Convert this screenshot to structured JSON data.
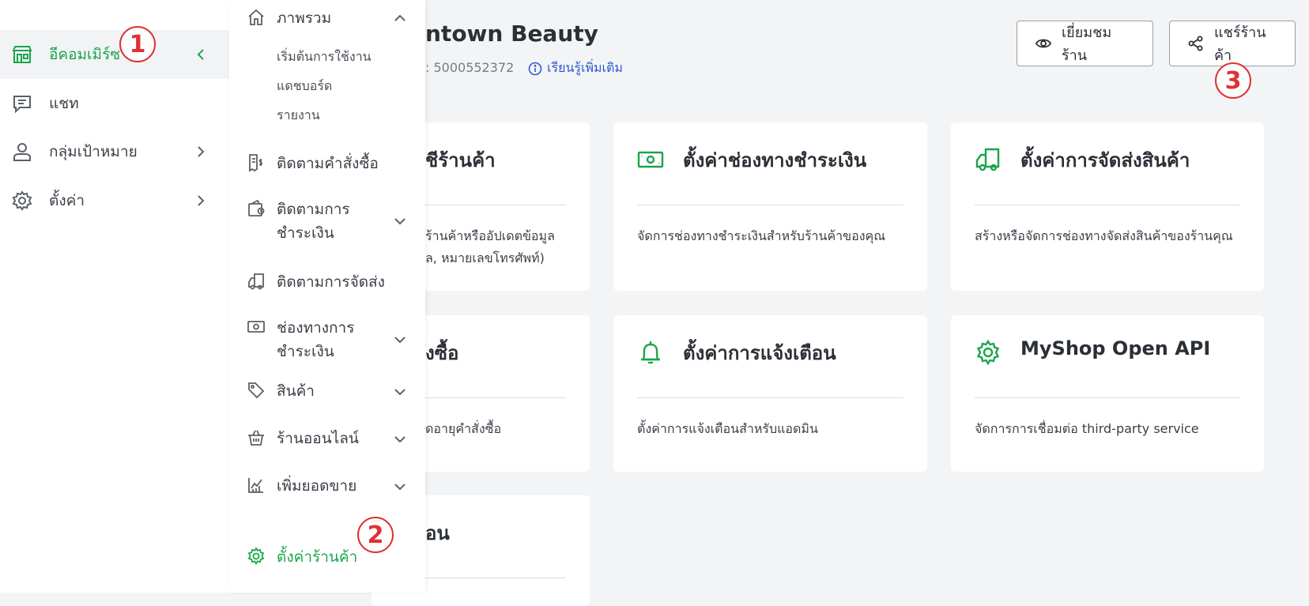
{
  "sidebar": {
    "items": [
      {
        "label": "อีคอมเมิร์ซ",
        "icon": "store-icon",
        "active": true
      },
      {
        "label": "แชท",
        "icon": "chat-icon"
      },
      {
        "label": "กลุ่มเป้าหมาย",
        "icon": "user-icon"
      },
      {
        "label": "ตั้งค่า",
        "icon": "gear-icon"
      }
    ]
  },
  "submenu": {
    "overview": {
      "label": "ภาพรวม",
      "sub": [
        "เริ่มต้นการใช้งาน",
        "แดชบอร์ด",
        "รายงาน"
      ]
    },
    "items": [
      {
        "label": "ติดตามคำสั่งซื้อ"
      },
      {
        "label": "ติดตามการ",
        "label2": "ชำระเงิน"
      },
      {
        "label": "ติดตามการจัดส่ง"
      },
      {
        "label": "ช่องทางการ",
        "label2": "ชำระเงิน"
      },
      {
        "label": "สินค้า"
      },
      {
        "label": "ร้านออนไลน์"
      },
      {
        "label": "เพิ่มยอดขาย"
      },
      {
        "label": "ตั้งค่าร้านค้า"
      }
    ]
  },
  "header": {
    "shop_name": "ntown Beauty",
    "shop_id": ": 5000552372",
    "learn_more": "เรียนรู้เพิ่มเติม",
    "visit_label": "เยี่ยมชมร้าน",
    "share_label": "แชร์ร้านค้า"
  },
  "cards": [
    {
      "title": "ชีร้านค้า",
      "desc": "ร้านค้าหรืออัปเดตข้อมูล",
      "desc2": "ล, หมายเลขโทรศัพท์)"
    },
    {
      "title": "ตั้งค่าช่องทางชำระเงิน",
      "desc": "จัดการช่องทางชำระเงินสำหรับร้านค้าของคุณ"
    },
    {
      "title": "ตั้งค่าการจัดส่งสินค้า",
      "desc": "สร้างหรือจัดการช่องทางจัดส่งสินค้าของร้านคุณ"
    },
    {
      "title": "ั่งซื้อ",
      "desc": "ดอายุคำสั่งซื้อ"
    },
    {
      "title": "ตั้งค่าการแจ้งเตือน",
      "desc": "ตั้งค่าการแจ้งเตือนสำหรับแอดมิน"
    },
    {
      "title": "MyShop Open API",
      "desc": "จัดการการเชื่อมต่อ third-party service"
    },
    {
      "title": "ือน"
    }
  ],
  "annotations": [
    "1",
    "2",
    "3"
  ],
  "colors": {
    "accent": "#1aa64a",
    "link": "#2c59d6",
    "annotation": "#e03131"
  }
}
